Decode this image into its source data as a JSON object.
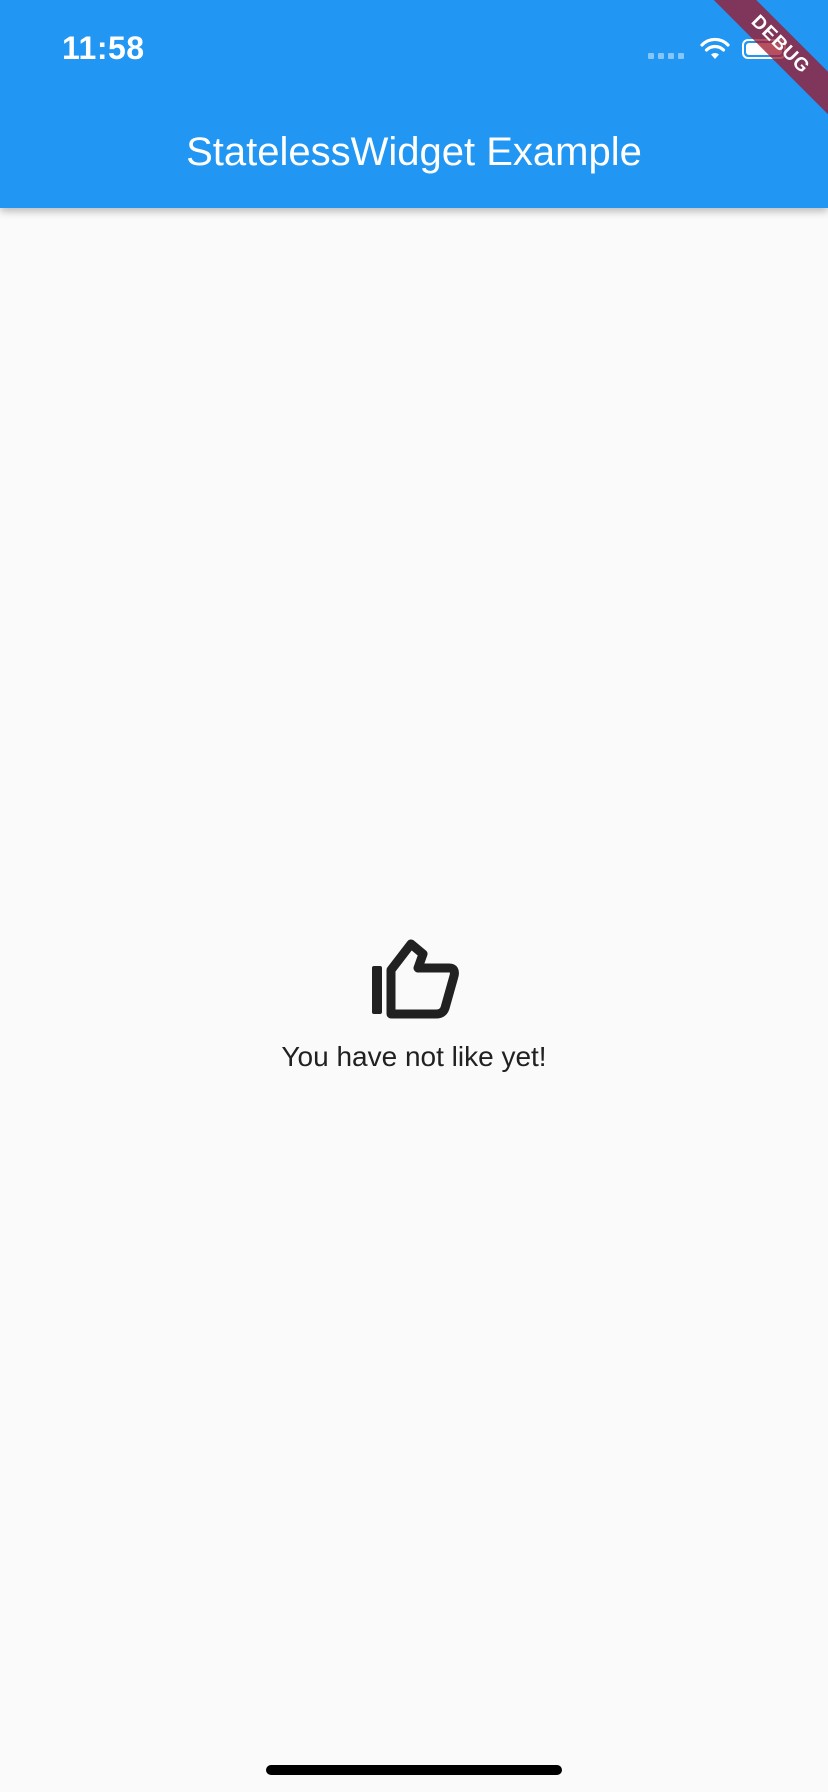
{
  "status_bar": {
    "time": "11:58",
    "icons": [
      "signal-icon",
      "wifi-icon",
      "battery-icon"
    ]
  },
  "app_bar": {
    "title": "StatelessWidget Example",
    "color": "#2196f3"
  },
  "debug_banner": {
    "label": "DEBUG"
  },
  "main": {
    "icon": "thumb-up-icon",
    "message": "You have not like yet!"
  }
}
